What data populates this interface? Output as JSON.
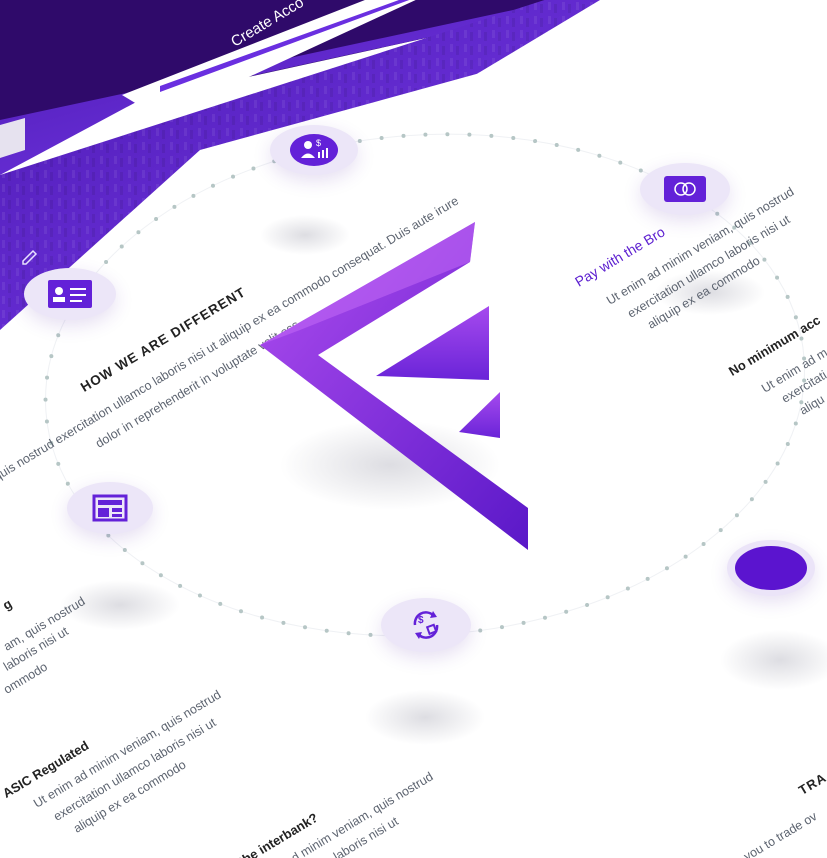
{
  "colors": {
    "background_dark": "#2f0a6a",
    "brand_purple": "#6a2fe0",
    "accent_purple": "#5d20d0",
    "icon_bg": "#ece6f8",
    "dotted_ring": "#b5c6c4"
  },
  "hero": {
    "cta_label": "Create Acco"
  },
  "section": {
    "heading": "HOW WE ARE DIFFERENT",
    "intro_lines": [
      "quis nostrud exercitation ullamco laboris nisi ut aliquip ex ea commodo consequat. Duis aute irure",
      "dolor in reprehenderit in voluptate velit ess"
    ]
  },
  "features": [
    {
      "title": "Pay with the Bro",
      "lines": [
        "Ut enim ad minim veniam, quis nostrud",
        "exercitation ullamco laboris nisi ut",
        "aliquip ex ea commodo"
      ]
    },
    {
      "title": "No minimum acc",
      "lines": [
        "Ut enim ad m",
        "exercitati",
        "aliqu"
      ]
    },
    {
      "title": "g",
      "lines": [
        "am, quis nostrud",
        "laboris nisi ut",
        "ommodo"
      ]
    },
    {
      "title": "ASIC Regulated",
      "lines": [
        "Ut enim ad minim veniam, quis nostrud",
        "exercitation ullamco laboris nisi ut",
        "aliquip ex ea commodo"
      ]
    },
    {
      "title": "the interbank?",
      "lines": [
        "ad minim veniam, quis nostrud",
        "laboris nisi ut"
      ]
    }
  ],
  "footer_right": {
    "title": "TRA",
    "line": "s you to trade ov"
  },
  "icons": [
    "investor-icon",
    "card-icon",
    "id-card-icon",
    "layout-icon",
    "exchange-icon",
    "logo-f-icon"
  ]
}
